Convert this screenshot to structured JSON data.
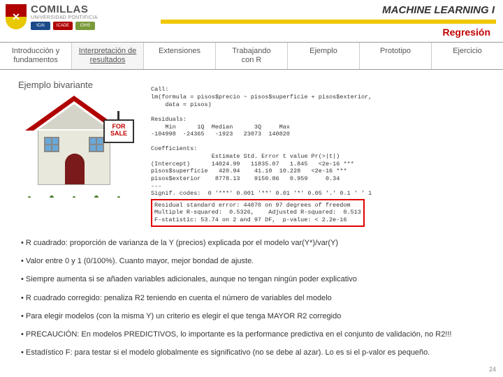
{
  "header": {
    "university": "COMILLAS",
    "subline": "UNIVERSIDAD PONTIFICIA",
    "badges": [
      "ICAI",
      "ICADE",
      "CIHS"
    ],
    "course": "MACHINE LEARNING I",
    "section": "Regresión"
  },
  "tabs": [
    {
      "l1": "Introducción y",
      "l2": "fundamentos"
    },
    {
      "l1": "Interpretación de",
      "l2": "resultados"
    },
    {
      "l1": "Extensiones",
      "l2": ""
    },
    {
      "l1": "Trabajando",
      "l2": "con R"
    },
    {
      "l1": "Ejemplo",
      "l2": ""
    },
    {
      "l1": "Prototipo",
      "l2": ""
    },
    {
      "l1": "Ejercicio",
      "l2": ""
    }
  ],
  "active_tab": 1,
  "content": {
    "title": "Ejemplo bivariante",
    "sign": "FOR\nSALE",
    "r_output_call": "Call:\nlm(formula = pisos$precio ~ pisos$superficie + pisos$exterior,\n    data = pisos)",
    "r_residuals_head": "Residuals:",
    "r_residuals_labels": "    Min      1Q  Median      3Q     Max",
    "r_residuals_vals": "-104998  -24365   -1923   23073  140820",
    "r_coef_head": "Coefficients:",
    "r_coef_labels": "                 Estimate Std. Error t value Pr(>|t|)",
    "r_coef_rows": "(Intercept)      14024.99   11835.07   1.845   <2e-16 ***\npisos$superficie   420.94    41.10  10.228   <2e-16 ***\npisos$exterior    8778.13    9150.86   0.959     0.34",
    "r_signif": "Signif. codes:  0 '***' 0.001 '**' 0.01 '*' 0.05 '.' 0.1 ' ' 1",
    "r_boxed": "Residual standard error: 44070 on 97 degrees of freedom\nMultiple R-squared:  0.5326,    Adjusted R-squared:  0.513\nF-statistic: 53.74 on 2 and 97 DF,  p-value: < 2.2e-16"
  },
  "bullets": [
    "R cuadrado: proporción de varianza de la Y (precios) explicada por el modelo var(Y*)/var(Y)",
    "Valor entre 0 y 1 (0/100%). Cuanto mayor, mejor bondad de ajuste.",
    "Siempre aumenta si se añaden variables adicionales, aunque no tengan ningún poder explicativo",
    "R cuadrado corregido: penaliza R2 teniendo en cuenta el número de variables del modelo",
    "Para elegir modelos (con la misma Y) un criterio es elegir el que tenga MAYOR R2 corregido",
    "PRECAUCIÓN: En modelos PREDICTIVOS, lo importante es la performance predictiva en el conjunto de validación, no R2!!!",
    "Estadístico F: para testar si el modelo globalmente es significativo (no se debe al azar). Lo es si el p-valor es pequeño."
  ],
  "page_number": "24"
}
